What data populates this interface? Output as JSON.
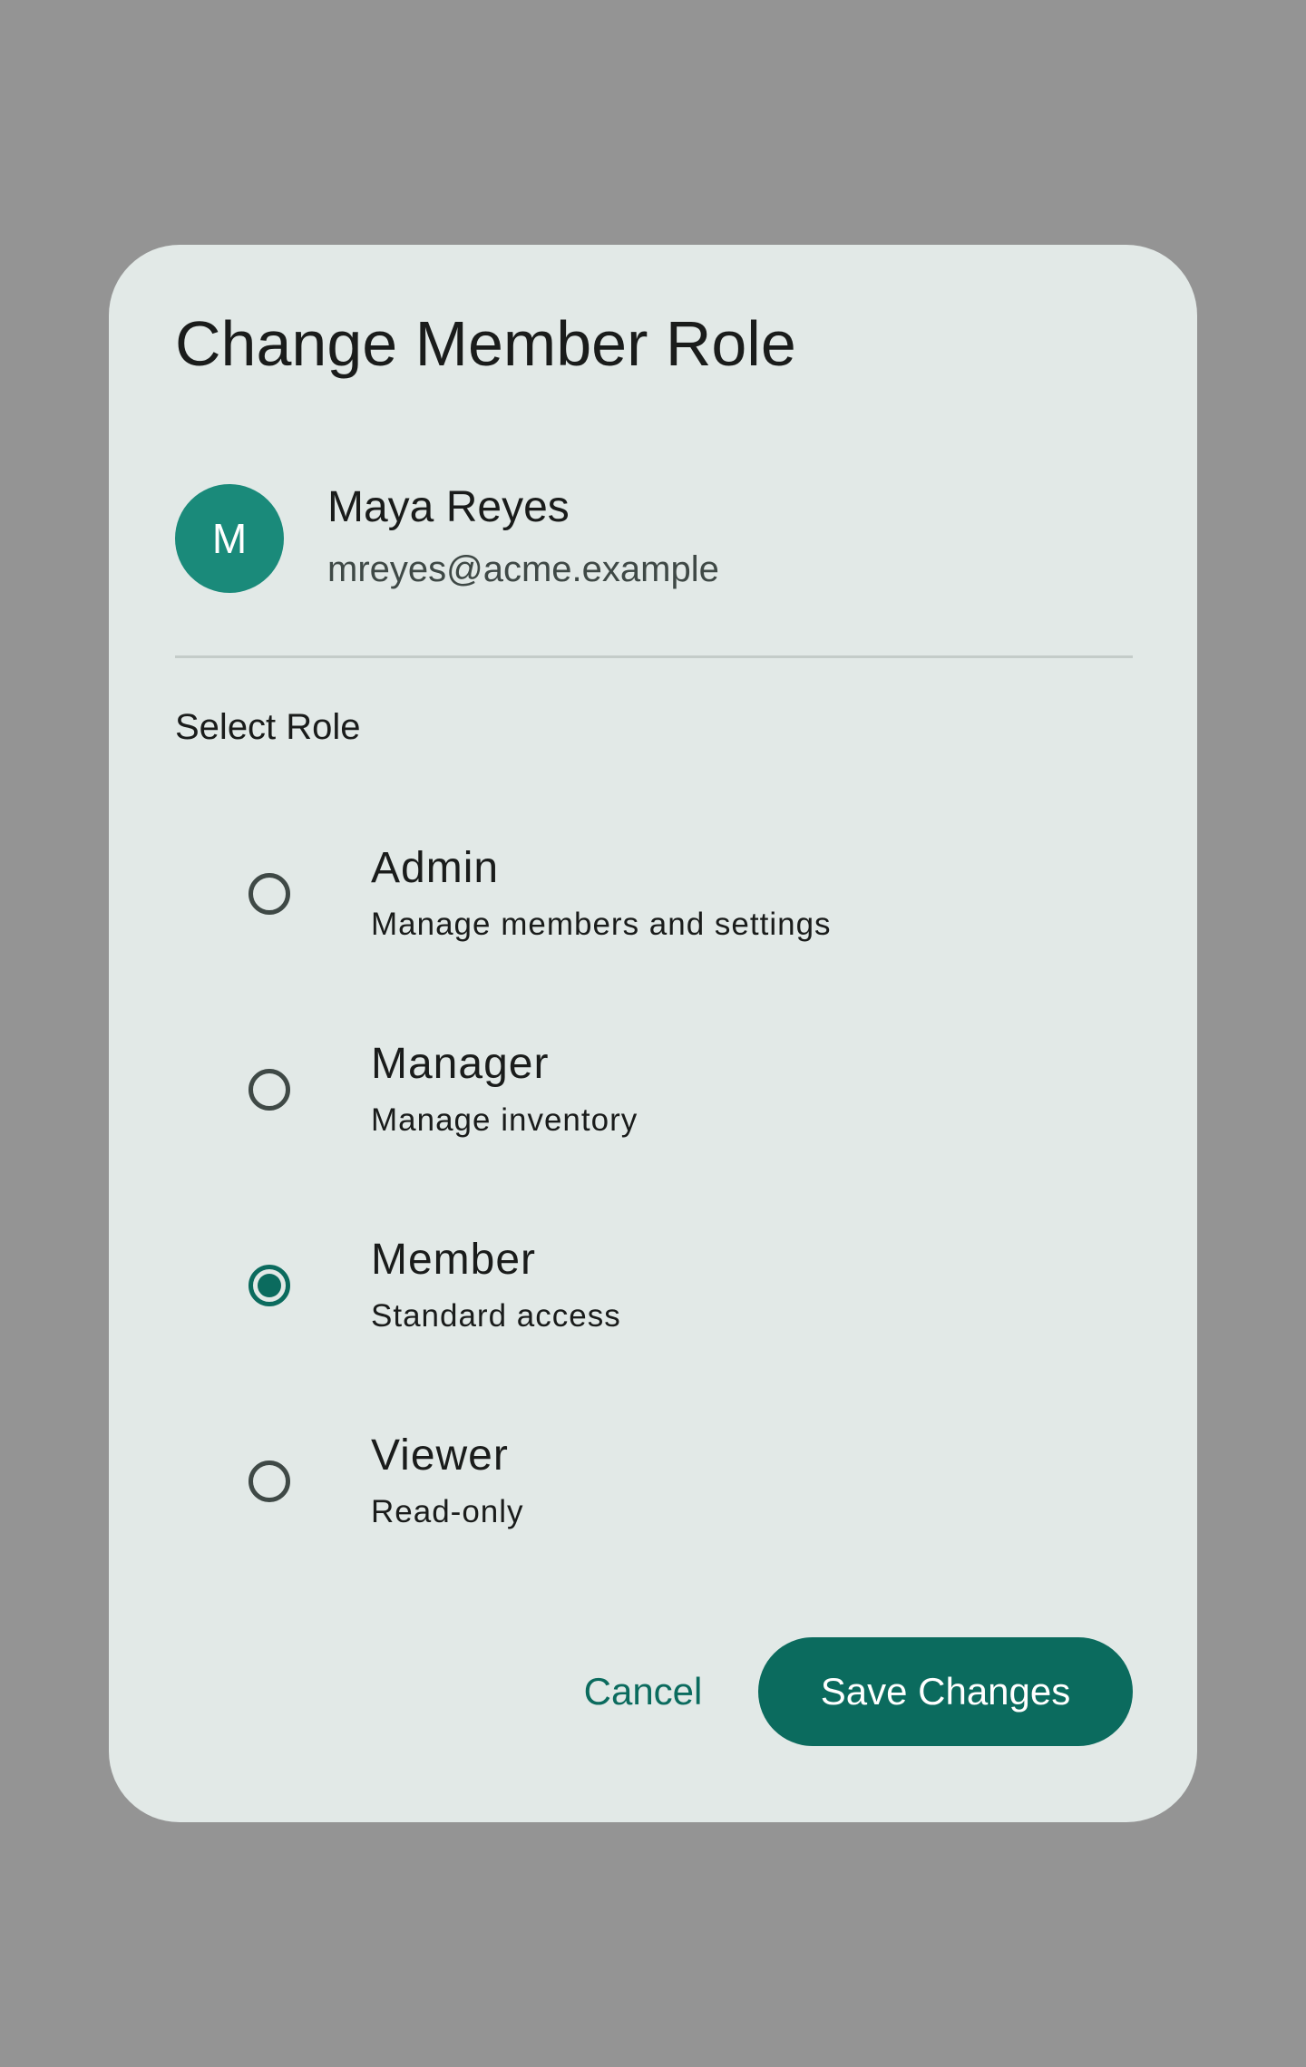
{
  "dialog": {
    "title": "Change Member Role",
    "user": {
      "avatar_initial": "M",
      "name": "Maya Reyes",
      "email": "mreyes@acme.example"
    },
    "section_label": "Select Role",
    "roles": [
      {
        "title": "Admin",
        "description": "Manage members and settings",
        "selected": false
      },
      {
        "title": "Manager",
        "description": "Manage inventory",
        "selected": false
      },
      {
        "title": "Member",
        "description": "Standard access",
        "selected": true
      },
      {
        "title": "Viewer",
        "description": "Read-only",
        "selected": false
      }
    ],
    "actions": {
      "cancel_label": "Cancel",
      "save_label": "Save Changes"
    }
  },
  "colors": {
    "scrim": "#949494",
    "surface": "#e2e9e7",
    "primary": "#0b6b5e",
    "avatar": "#1a8a7a",
    "on_surface": "#1a1c1b",
    "on_surface_variant": "#3f4946",
    "divider": "#c4ccc9"
  }
}
